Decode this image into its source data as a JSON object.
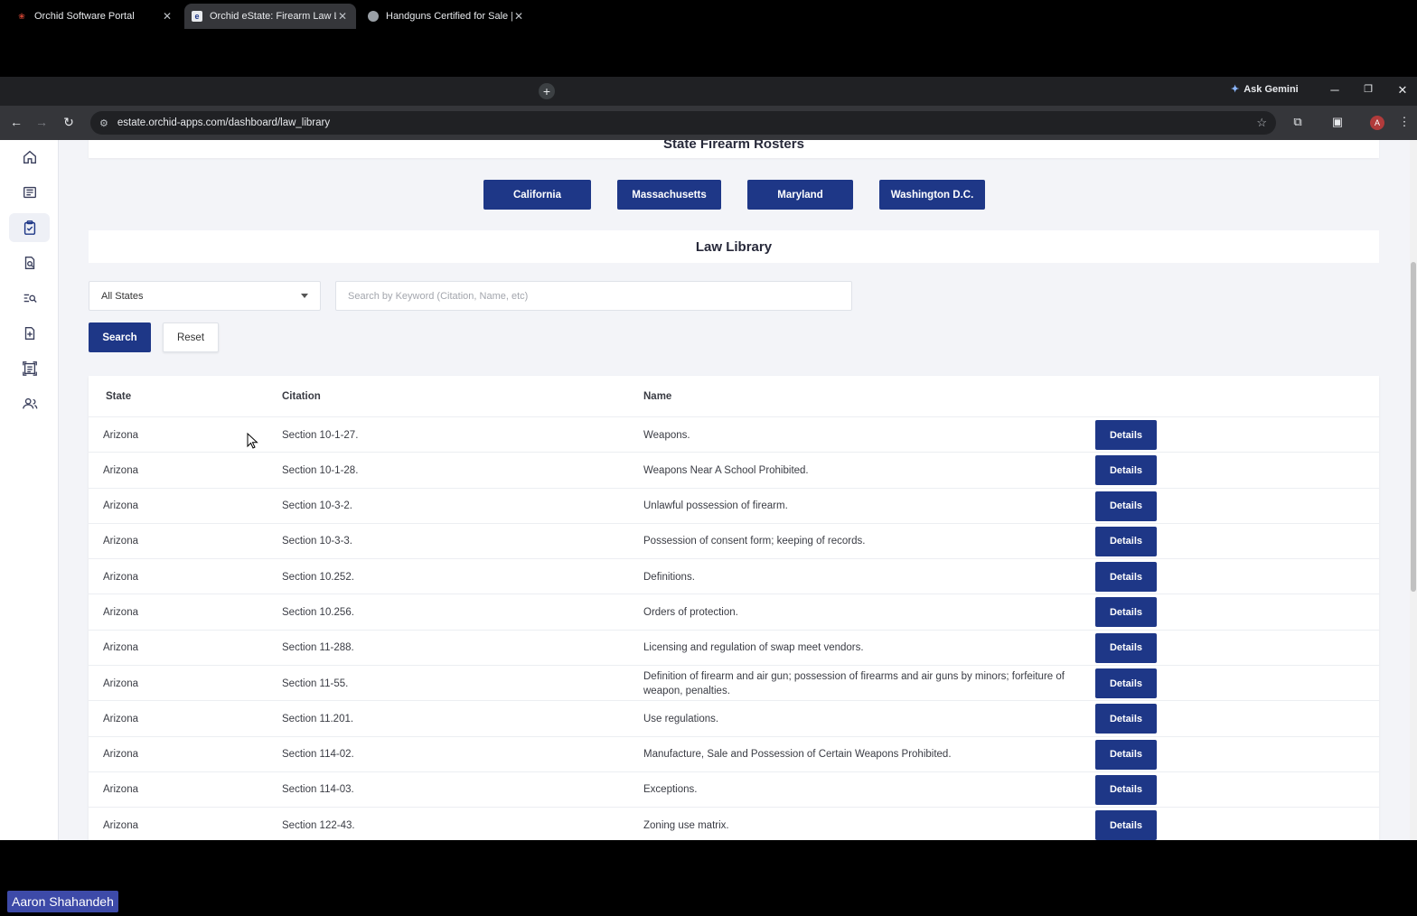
{
  "browser": {
    "tabs": [
      {
        "label": "Orchid Software Portal",
        "active": false
      },
      {
        "label": "Orchid eState: Firearm Law Libr",
        "active": true
      },
      {
        "label": "Handguns Certified for Sale | St",
        "active": false
      }
    ],
    "new_tab": "+",
    "gemini_label": "Ask Gemini",
    "url": "estate.orchid-apps.com/dashboard/law_library",
    "profile_initial": "A"
  },
  "sidebar": {
    "items": [
      {
        "icon": "home-icon",
        "active": false
      },
      {
        "icon": "newspaper-icon",
        "active": false
      },
      {
        "icon": "clipboard-check-icon",
        "active": true
      },
      {
        "icon": "document-search-icon",
        "active": false
      },
      {
        "icon": "list-search-icon",
        "active": false
      },
      {
        "icon": "file-add-icon",
        "active": false
      },
      {
        "icon": "report-icon",
        "active": false
      },
      {
        "icon": "users-icon",
        "active": false
      }
    ]
  },
  "rosters": {
    "title": "State Firearm Rosters",
    "buttons": [
      "California",
      "Massachusetts",
      "Maryland",
      "Washington D.C."
    ]
  },
  "library": {
    "title": "Law Library",
    "state_select": "All States",
    "search_placeholder": "Search by Keyword (Citation, Name, etc)",
    "search_label": "Search",
    "reset_label": "Reset",
    "columns": {
      "state": "State",
      "citation": "Citation",
      "name": "Name"
    },
    "details_label": "Details",
    "rows": [
      {
        "state": "Arizona",
        "citation": "Section 10-1-27.",
        "name": "Weapons."
      },
      {
        "state": "Arizona",
        "citation": "Section 10-1-28.",
        "name": "Weapons Near A School Prohibited."
      },
      {
        "state": "Arizona",
        "citation": "Section 10-3-2.",
        "name": "Unlawful possession of firearm."
      },
      {
        "state": "Arizona",
        "citation": "Section 10-3-3.",
        "name": "Possession of consent form; keeping of records."
      },
      {
        "state": "Arizona",
        "citation": "Section 10.252.",
        "name": "Definitions."
      },
      {
        "state": "Arizona",
        "citation": "Section 10.256.",
        "name": "Orders of protection."
      },
      {
        "state": "Arizona",
        "citation": "Section 11-288.",
        "name": "Licensing and regulation of swap meet vendors."
      },
      {
        "state": "Arizona",
        "citation": "Section 11-55.",
        "name": "Definition of firearm and air gun; possession of firearms and air guns by minors; forfeiture of weapon, penalties."
      },
      {
        "state": "Arizona",
        "citation": "Section 11.201.",
        "name": "Use regulations."
      },
      {
        "state": "Arizona",
        "citation": "Section 114-02.",
        "name": "Manufacture, Sale and Possession of Certain Weapons Prohibited."
      },
      {
        "state": "Arizona",
        "citation": "Section 114-03.",
        "name": "Exceptions."
      },
      {
        "state": "Arizona",
        "citation": "Section 122-43.",
        "name": "Zoning use matrix."
      }
    ]
  },
  "caption": "Aaron Shahandeh",
  "colors": {
    "primary": "#1e3787",
    "page_bg": "#f3f4f8",
    "chrome_dark": "#202124",
    "chrome_toolbar": "#35363a"
  }
}
